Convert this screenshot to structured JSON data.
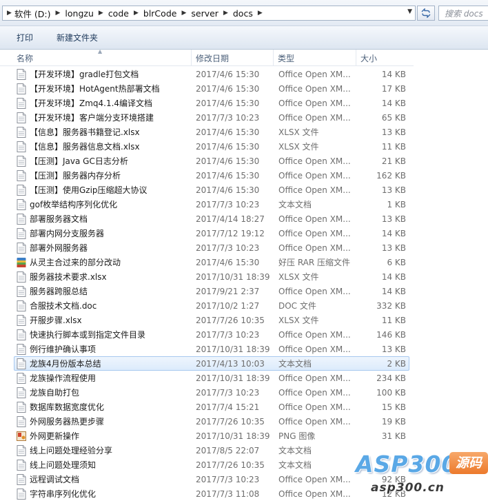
{
  "address": {
    "crumbs": [
      "软件 (D:)",
      "longzu",
      "code",
      "blrCode",
      "server",
      "docs"
    ]
  },
  "search": {
    "placeholder": "搜索 docs"
  },
  "toolbar": {
    "print_label": "打印",
    "new_folder_label": "新建文件夹"
  },
  "columns": {
    "name": "名称",
    "date": "修改日期",
    "type": "类型",
    "size": "大小"
  },
  "files": [
    {
      "name": "【开发环境】gradle打包文档",
      "date": "2017/4/6 15:30",
      "type": "Office Open XM...",
      "size": "14 KB",
      "icon": "doc"
    },
    {
      "name": "【开发环境】HotAgent热部署文档",
      "date": "2017/4/6 15:30",
      "type": "Office Open XM...",
      "size": "17 KB",
      "icon": "doc"
    },
    {
      "name": "【开发环境】Zmq4.1.4编译文档",
      "date": "2017/4/6 15:30",
      "type": "Office Open XM...",
      "size": "14 KB",
      "icon": "doc"
    },
    {
      "name": "【开发环境】客户端分支环境搭建",
      "date": "2017/7/3 10:23",
      "type": "Office Open XM...",
      "size": "65 KB",
      "icon": "doc"
    },
    {
      "name": "【信息】服务器书籍登记.xlsx",
      "date": "2017/4/6 15:30",
      "type": "XLSX 文件",
      "size": "13 KB",
      "icon": "doc"
    },
    {
      "name": "【信息】服务器信息文档.xlsx",
      "date": "2017/4/6 15:30",
      "type": "XLSX 文件",
      "size": "11 KB",
      "icon": "doc"
    },
    {
      "name": "【压测】Java GC日志分析",
      "date": "2017/4/6 15:30",
      "type": "Office Open XM...",
      "size": "21 KB",
      "icon": "doc"
    },
    {
      "name": "【压测】服务器内存分析",
      "date": "2017/4/6 15:30",
      "type": "Office Open XM...",
      "size": "162 KB",
      "icon": "doc"
    },
    {
      "name": "【压测】使用Gzip压缩超大协议",
      "date": "2017/4/6 15:30",
      "type": "Office Open XM...",
      "size": "13 KB",
      "icon": "doc"
    },
    {
      "name": "gof枚举结构序列化优化",
      "date": "2017/7/3 10:23",
      "type": "文本文档",
      "size": "1 KB",
      "icon": "doc"
    },
    {
      "name": "部署服务器文档",
      "date": "2017/4/14 18:27",
      "type": "Office Open XM...",
      "size": "13 KB",
      "icon": "doc"
    },
    {
      "name": "部署内网分支服务器",
      "date": "2017/7/12 19:12",
      "type": "Office Open XM...",
      "size": "14 KB",
      "icon": "doc"
    },
    {
      "name": "部署外网服务器",
      "date": "2017/7/3 10:23",
      "type": "Office Open XM...",
      "size": "13 KB",
      "icon": "doc"
    },
    {
      "name": "从灵主合过来的部分改动",
      "date": "2017/4/6 15:30",
      "type": "好压 RAR 压缩文件",
      "size": "6 KB",
      "icon": "rar"
    },
    {
      "name": "服务器技术要求.xlsx",
      "date": "2017/10/31 18:39",
      "type": "XLSX 文件",
      "size": "14 KB",
      "icon": "doc"
    },
    {
      "name": "服务器跨服总结",
      "date": "2017/9/21 2:37",
      "type": "Office Open XM...",
      "size": "14 KB",
      "icon": "doc"
    },
    {
      "name": "合服技术文档.doc",
      "date": "2017/10/2 1:27",
      "type": "DOC 文件",
      "size": "332 KB",
      "icon": "doc"
    },
    {
      "name": "开服步骤.xlsx",
      "date": "2017/7/26 10:35",
      "type": "XLSX 文件",
      "size": "11 KB",
      "icon": "doc"
    },
    {
      "name": "快速执行脚本或到指定文件目录",
      "date": "2017/7/3 10:23",
      "type": "Office Open XM...",
      "size": "146 KB",
      "icon": "doc"
    },
    {
      "name": "例行维护确认事项",
      "date": "2017/10/31 18:39",
      "type": "Office Open XM...",
      "size": "13 KB",
      "icon": "doc"
    },
    {
      "name": "龙族4月份版本总结",
      "date": "2017/4/13 10:03",
      "type": "文本文档",
      "size": "2 KB",
      "icon": "doc",
      "selected": true
    },
    {
      "name": "龙族操作流程使用",
      "date": "2017/10/31 18:39",
      "type": "Office Open XM...",
      "size": "234 KB",
      "icon": "doc"
    },
    {
      "name": "龙族自助打包",
      "date": "2017/7/3 10:23",
      "type": "Office Open XM...",
      "size": "100 KB",
      "icon": "doc"
    },
    {
      "name": "数据库数据宽度优化",
      "date": "2017/7/4 15:21",
      "type": "Office Open XM...",
      "size": "15 KB",
      "icon": "doc"
    },
    {
      "name": "外网服务器热更步骤",
      "date": "2017/7/26 10:35",
      "type": "Office Open XM...",
      "size": "19 KB",
      "icon": "doc"
    },
    {
      "name": "外网更新操作",
      "date": "2017/10/31 18:39",
      "type": "PNG 图像",
      "size": "31 KB",
      "icon": "png"
    },
    {
      "name": "线上问题处理经验分享",
      "date": "2017/8/5 22:07",
      "type": "文本文档",
      "size": "",
      "icon": "doc"
    },
    {
      "name": "线上问题处理须知",
      "date": "2017/7/26 10:35",
      "type": "文本文档",
      "size": "",
      "icon": "doc"
    },
    {
      "name": "远程调试文档",
      "date": "2017/7/3 10:23",
      "type": "Office Open XM...",
      "size": "92 KB",
      "icon": "doc"
    },
    {
      "name": "字符串序列化优化",
      "date": "2017/7/3 11:08",
      "type": "Office Open XM...",
      "size": "12 KB",
      "icon": "doc"
    }
  ],
  "watermark": {
    "brand": "ASP300",
    "badge": "源码",
    "url": "asp300.cn"
  }
}
